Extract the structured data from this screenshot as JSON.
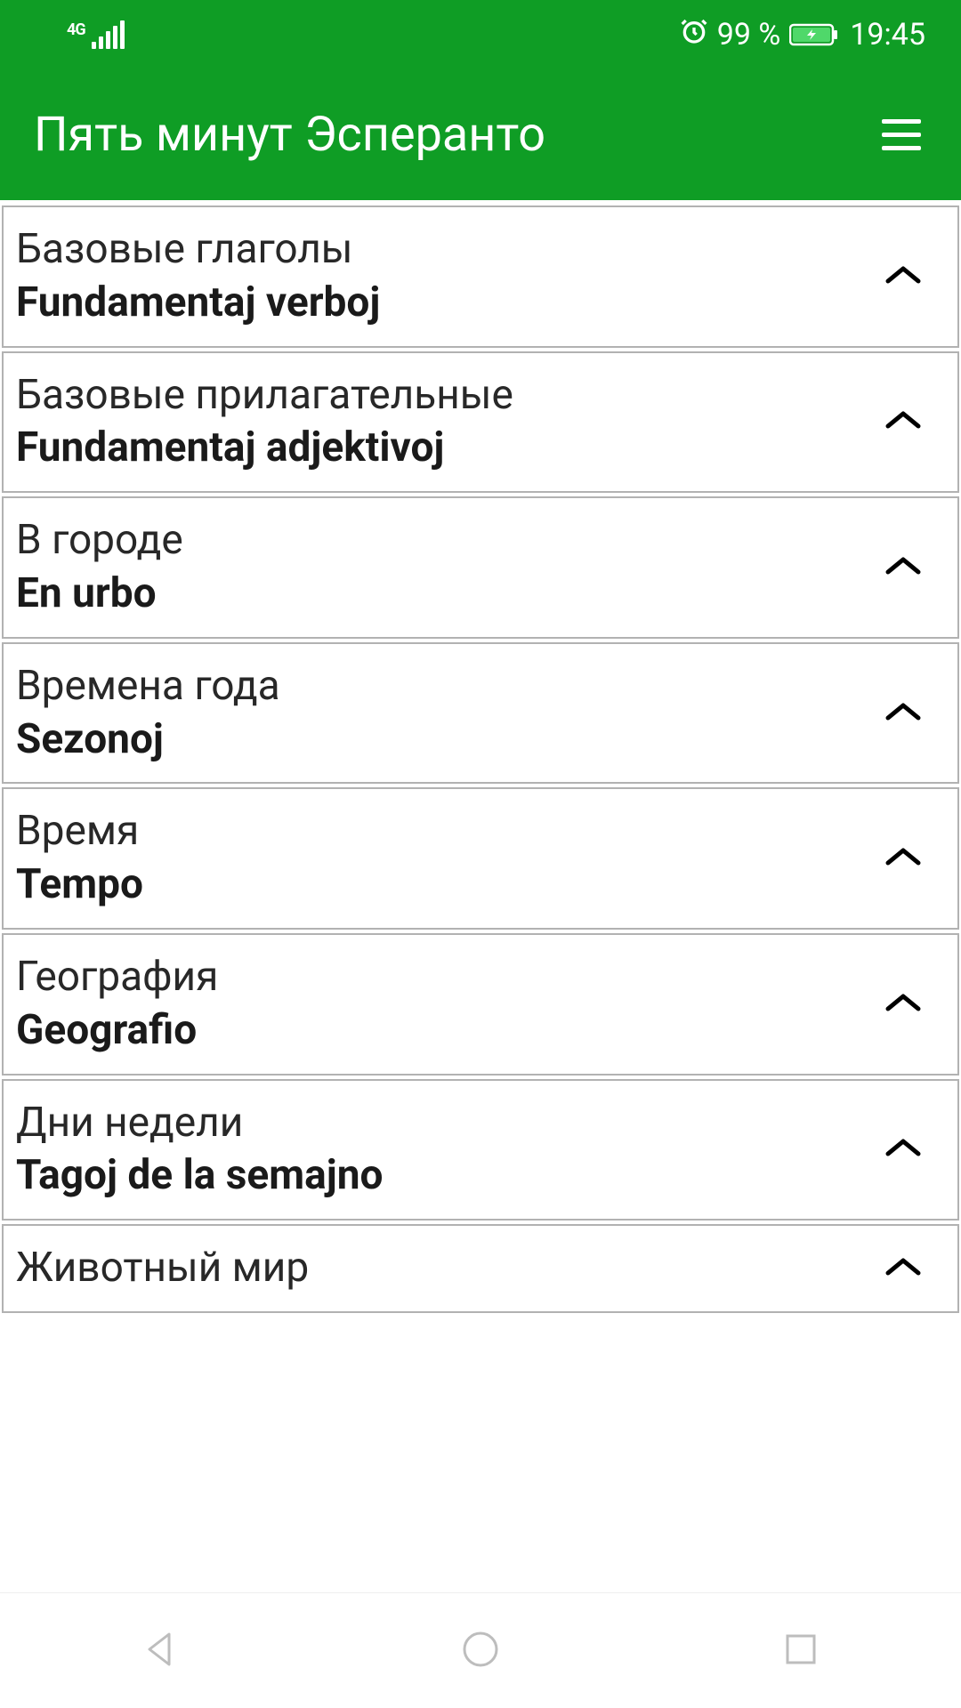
{
  "status": {
    "network": "4G",
    "battery": "99 %",
    "time": "19:45"
  },
  "header": {
    "title": "Пять минут Эсперанто"
  },
  "items": [
    {
      "title": "Базовые глаголы",
      "subtitle": "Fundamentaj verboj"
    },
    {
      "title": "Базовые прилагательные",
      "subtitle": "Fundamentaj adjektivoj"
    },
    {
      "title": "В городе",
      "subtitle": "En urbo"
    },
    {
      "title": "Времена года",
      "subtitle": "Sezonoj"
    },
    {
      "title": "Время",
      "subtitle": "Tempo"
    },
    {
      "title": "География",
      "subtitle": "Geografio"
    },
    {
      "title": "Дни недели",
      "subtitle": "Tagoj de la semajno"
    },
    {
      "title": "Животный мир",
      "subtitle": ""
    }
  ]
}
